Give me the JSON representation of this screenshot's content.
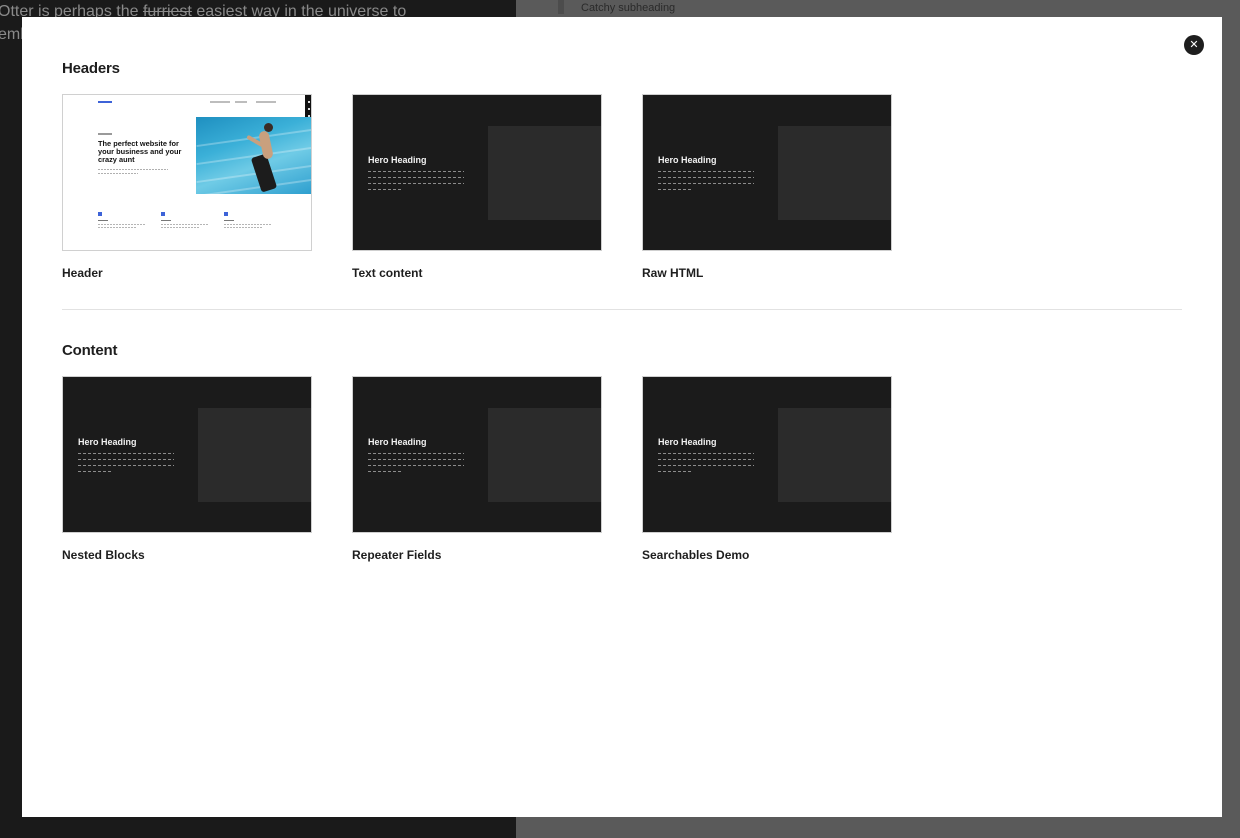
{
  "background": {
    "text_line1_before": "Otter is perhaps the ",
    "text_line1_struck": "furriest",
    "text_line1_after": " easiest way in the universe to",
    "text_line2": "emb",
    "subheading": "Catchy subheading"
  },
  "modal": {
    "close_label": "✕",
    "sections": [
      {
        "title": "Headers",
        "blocks": [
          {
            "label": "Header",
            "preview": "light",
            "preview_text": {
              "headline": "The perfect website for your business and your crazy aunt"
            }
          },
          {
            "label": "Text content",
            "preview": "dark",
            "preview_text": {
              "headline": "Hero Heading"
            }
          },
          {
            "label": "Raw HTML",
            "preview": "dark",
            "preview_text": {
              "headline": "Hero Heading"
            }
          }
        ]
      },
      {
        "title": "Content",
        "blocks": [
          {
            "label": "Nested Blocks",
            "preview": "dark",
            "preview_text": {
              "headline": "Hero Heading"
            }
          },
          {
            "label": "Repeater Fields",
            "preview": "dark",
            "preview_text": {
              "headline": "Hero Heading"
            }
          },
          {
            "label": "Searchables Demo",
            "preview": "dark",
            "preview_text": {
              "headline": "Hero Heading"
            }
          }
        ]
      }
    ]
  },
  "colors": {
    "modal_bg": "#ffffff",
    "preview_dark": "#1b1b1b",
    "preview_panel": "#2b2b2b",
    "accent_blue": "#3d63d8",
    "text_dark": "#1e1e1e"
  }
}
